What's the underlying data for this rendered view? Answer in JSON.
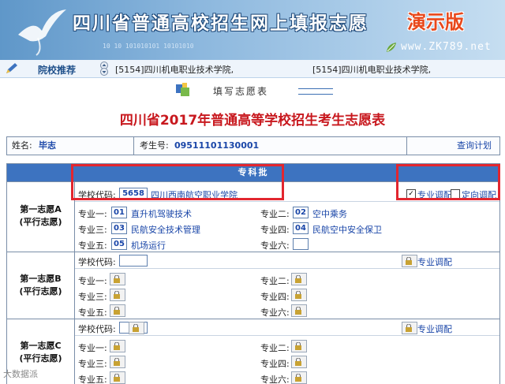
{
  "banner": {
    "title": "四川省普通高校招生网上填报志愿",
    "demo": "演示版",
    "bits": "10 10 101010101    10101010",
    "url": "www.ZK789.net"
  },
  "recommend": {
    "label": "院校推荐",
    "items": [
      "[5154]四川机电职业技术学院,",
      "[5154]四川机电职业技术学院,"
    ]
  },
  "subheading": "填写志愿表",
  "main_title": "四川省2017年普通高等学校招生考生志愿表",
  "info": {
    "name_label": "姓名:",
    "name_value": "毕志",
    "id_label": "考生号:",
    "id_value": "09511101130001",
    "query": "查询计划"
  },
  "table": {
    "batch": "专科批",
    "school_code_label": "学校代码:",
    "adjust_label": "专业调配",
    "directional_label": "定向调配",
    "major_labels": [
      "专业一:",
      "专业二:",
      "专业三:",
      "专业四:",
      "专业五:",
      "专业六:"
    ],
    "groups": [
      {
        "name_line1": "第一志愿A",
        "name_line2": "(平行志愿)",
        "school_code": "5658",
        "school_name": "四川西南航空职业学院",
        "majors": [
          {
            "code": "01",
            "name": "直升机驾驶技术"
          },
          {
            "code": "02",
            "name": "空中乘务"
          },
          {
            "code": "03",
            "name": "民航安全技术管理"
          },
          {
            "code": "04",
            "name": "民航空中安全保卫"
          },
          {
            "code": "05",
            "name": "机场运行"
          },
          {
            "code": "",
            "name": ""
          }
        ]
      },
      {
        "name_line1": "第一志愿B",
        "name_line2": "(平行志愿)"
      },
      {
        "name_line1": "第一志愿C",
        "name_line2": "(平行志愿)"
      }
    ]
  },
  "watermark": "大数据派"
}
